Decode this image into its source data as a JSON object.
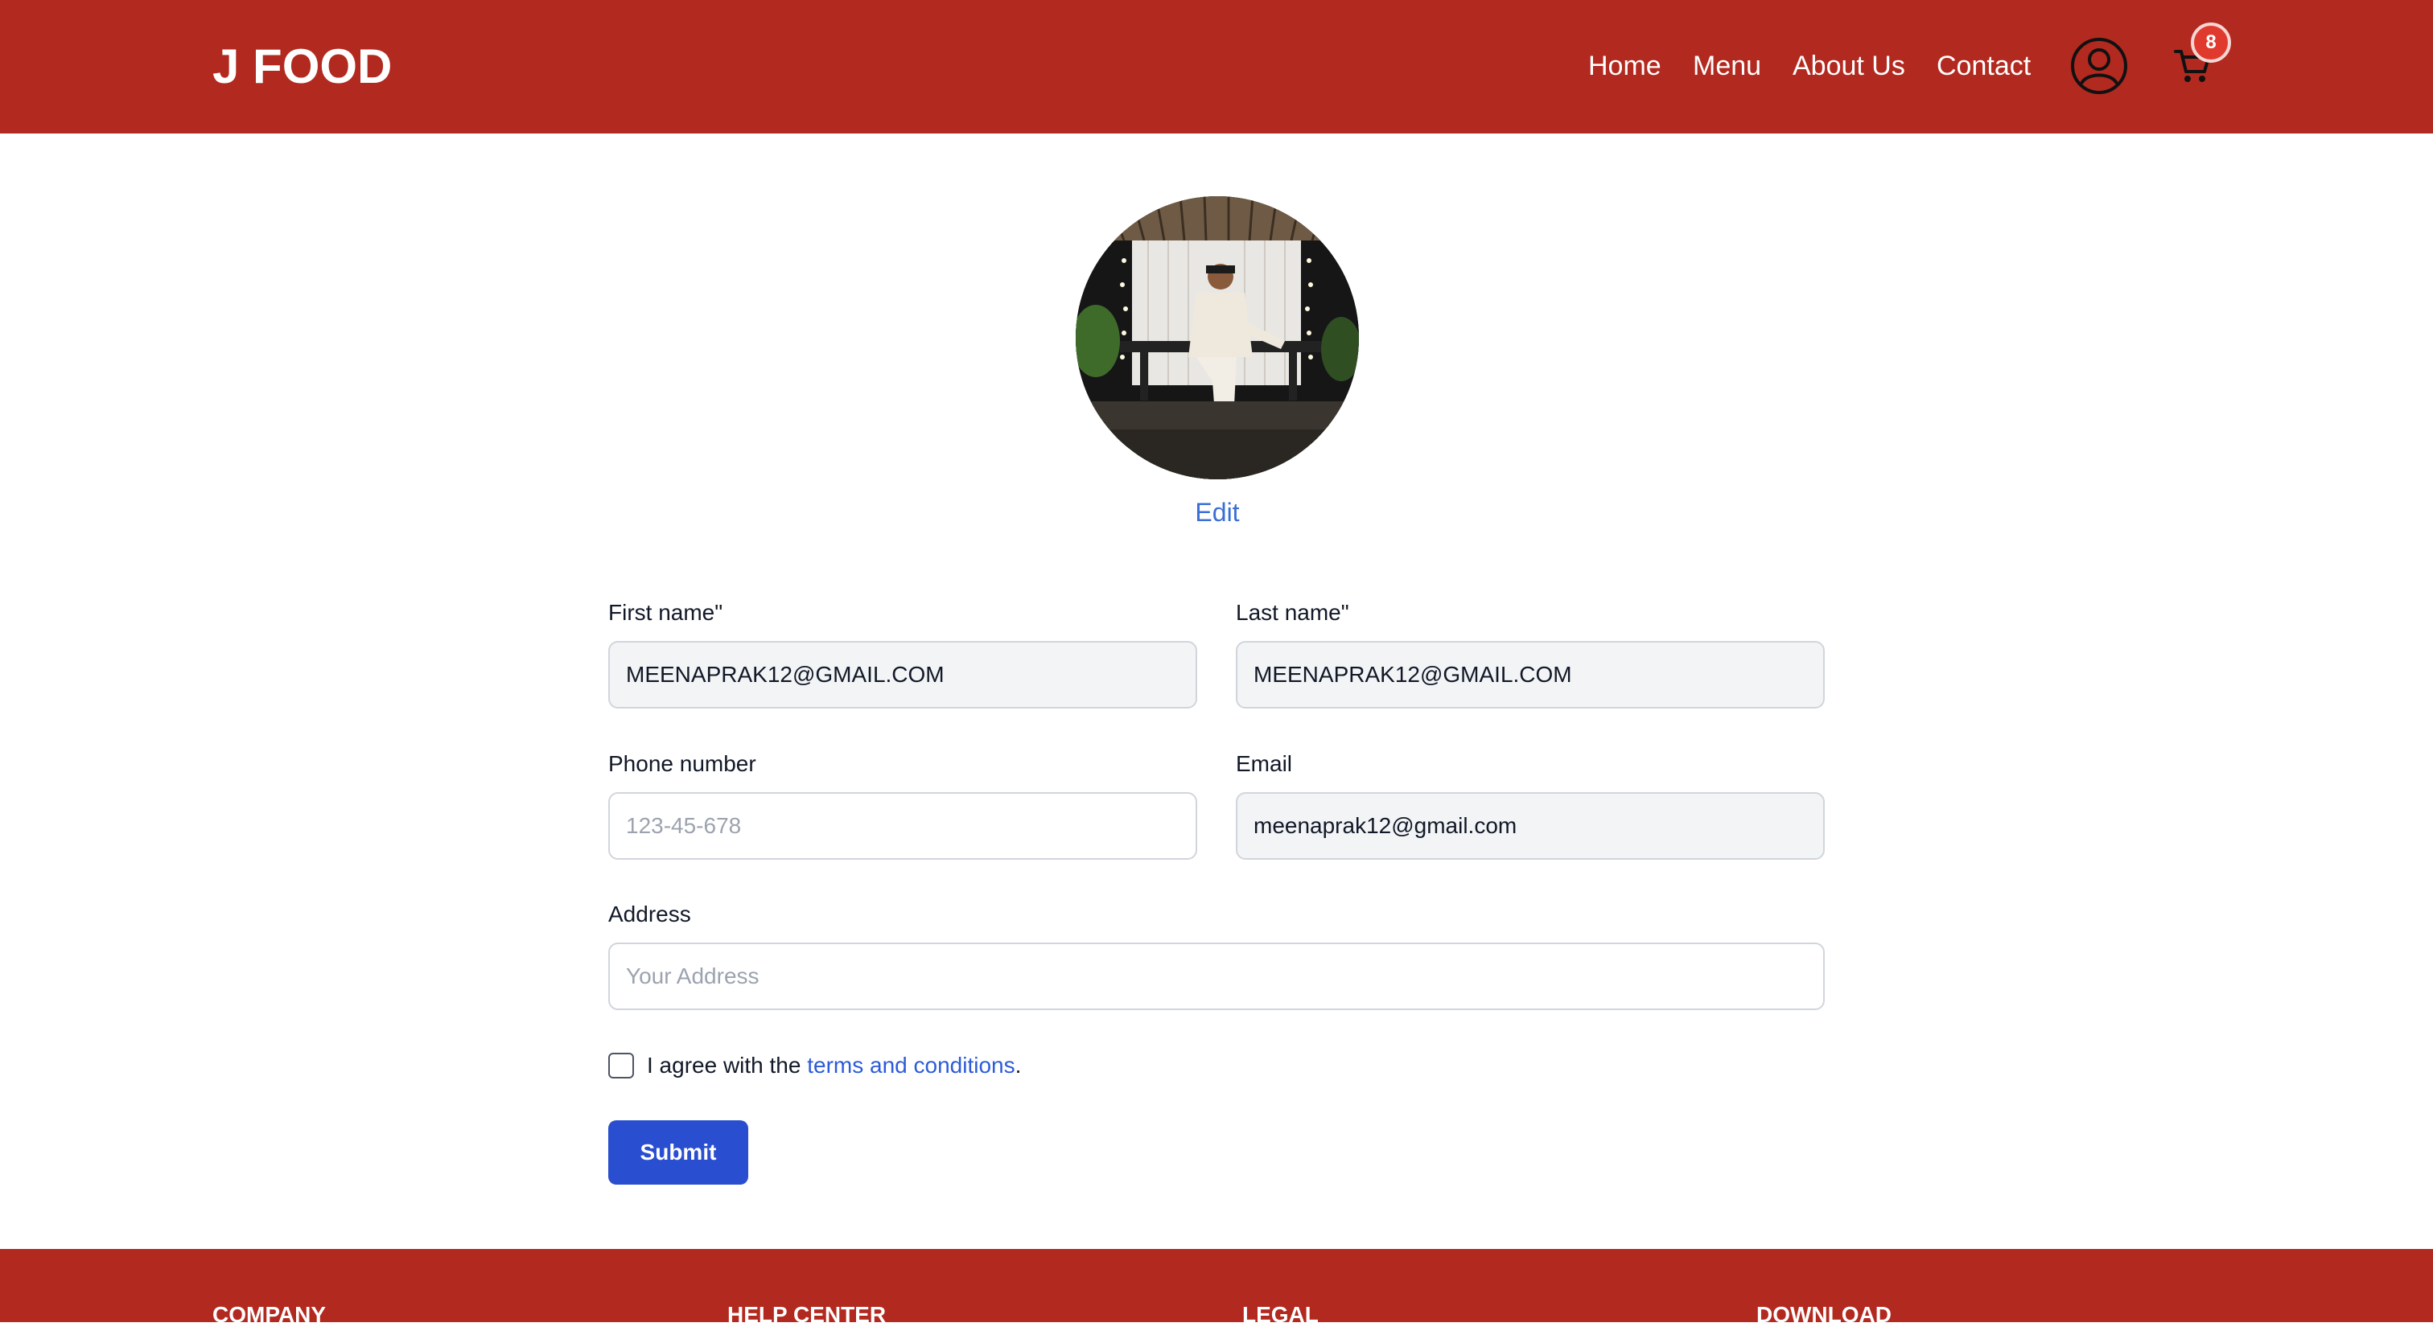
{
  "header": {
    "brand": "J FOOD",
    "nav": [
      "Home",
      "Menu",
      "About Us",
      "Contact"
    ],
    "cart_count": "8",
    "icons": {
      "user": "user-circle-icon",
      "cart": "shopping-cart-icon"
    },
    "colors": {
      "bar": "#b2291f",
      "badge": "#e03a2f"
    }
  },
  "profile": {
    "avatar": "profile-photo",
    "edit_label": "Edit"
  },
  "form": {
    "first_name": {
      "label": "First name\"",
      "value": "MEENAPRAK12@GMAIL.COM"
    },
    "last_name": {
      "label": "Last name\"",
      "value": "MEENAPRAK12@GMAIL.COM"
    },
    "phone": {
      "label": "Phone number",
      "value": "",
      "placeholder": "123-45-678"
    },
    "email": {
      "label": "Email",
      "value": "meenaprak12@gmail.com"
    },
    "address": {
      "label": "Address",
      "value": "",
      "placeholder": "Your Address"
    },
    "agree": {
      "prefix": "I agree with the ",
      "link": "terms and conditions",
      "suffix": ".",
      "checked": false
    },
    "submit_label": "Submit",
    "colors": {
      "link": "#2b5bd7",
      "submit": "#2a4ed0"
    }
  },
  "footer": {
    "columns": [
      "COMPANY",
      "HELP CENTER",
      "LEGAL",
      "DOWNLOAD"
    ]
  }
}
